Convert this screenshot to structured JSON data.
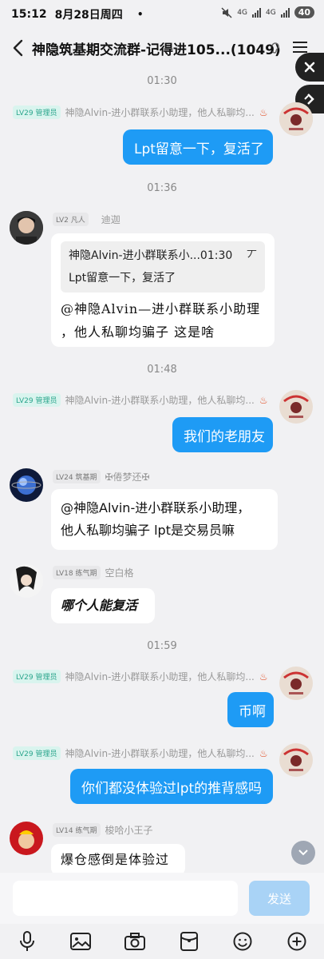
{
  "status": {
    "time": "15:12",
    "date": "8月28日周四",
    "dot": "•",
    "network": "4G",
    "battery": "40"
  },
  "header": {
    "title": "神隐筑基期交流群-记得进105...(1049)"
  },
  "messages": {
    "t1": "01:30",
    "m1_badge": "LV29 管理员",
    "m1_name": "神隐Alvin-进小群联系小助理，他人私聊均...",
    "m1_text": "Lpt留意一下，复活了",
    "t2": "01:36",
    "m2_badge": "LV2 凡人",
    "m2_name": "迪迦",
    "m2_quote_title": "神隐Alvin-进小群联系小...01:30",
    "m2_quote_arrow": "丆",
    "m2_quote_text": "Lpt留意一下，复活了",
    "m2_line1": "@神隐Alvin—进小群联系小助理",
    "m2_line2": "，他人私聊均骗子 这是啥",
    "t3": "01:48",
    "m3_badge": "LV29 管理员",
    "m3_name": "神隐Alvin-进小群联系小助理，他人私聊均...",
    "m3_text": "我们的老朋友",
    "m4_badge": "LV24 筑基期",
    "m4_name": "✠倦梦还✠",
    "m4_line1": "@神隐Alvin-进小群联系小助理，",
    "m4_line2": "他人私聊均骗子 lpt是交易员嘛",
    "m5_badge": "LV18 练气期",
    "m5_name": "空白格",
    "m5_text": "哪个人能复活",
    "t4": "01:59",
    "m6_badge": "LV29 管理员",
    "m6_name": "神隐Alvin-进小群联系小助理，他人私聊均...",
    "m6_text": "币啊",
    "m7_badge": "LV29 管理员",
    "m7_name": "神隐Alvin-进小群联系小助理，他人私聊均...",
    "m7_text": "你们都没体验过lpt的推背感吗",
    "m8_badge": "LV14 练气期",
    "m8_name": "梭哈小王子",
    "m8_text": "爆仓感倒是体验过"
  },
  "input": {
    "placeholder": "",
    "send_label": "发送"
  },
  "colors": {
    "outgoing_bubble": "#1e9bf5",
    "admin_badge": "#2aa58c",
    "background": "#f1f1f3"
  }
}
